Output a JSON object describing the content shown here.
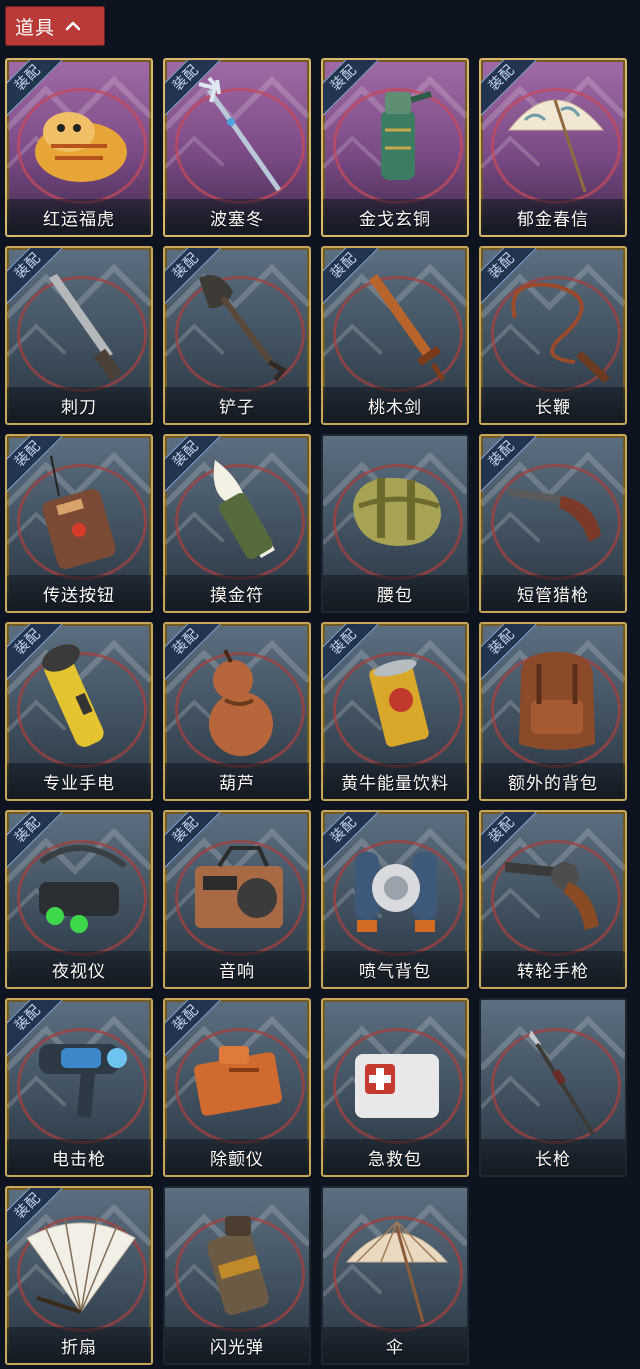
{
  "header": {
    "title": "道具",
    "chevron_icon": "chevron-up-icon"
  },
  "badge_label": "装配",
  "items": [
    {
      "name": "红运福虎",
      "equipped": true,
      "rarity": "purple",
      "gold_frame": true,
      "icon": "tiger-pillow-icon",
      "color": "#e7a437"
    },
    {
      "name": "波塞冬",
      "equipped": true,
      "rarity": "purple",
      "gold_frame": true,
      "icon": "trident-icon",
      "color": "#b9c9d8"
    },
    {
      "name": "金戈玄铜",
      "equipped": true,
      "rarity": "purple",
      "gold_frame": true,
      "icon": "bronze-grenade-icon",
      "color": "#3b7c63"
    },
    {
      "name": "郁金春信",
      "equipped": true,
      "rarity": "purple",
      "gold_frame": true,
      "icon": "paper-umbrella-icon",
      "color": "#f2e7d3"
    },
    {
      "name": "刺刀",
      "equipped": true,
      "rarity": "grey",
      "gold_frame": true,
      "icon": "bayonet-icon",
      "color": "#8a8f93"
    },
    {
      "name": "铲子",
      "equipped": true,
      "rarity": "grey",
      "gold_frame": true,
      "icon": "shovel-icon",
      "color": "#3e3a36"
    },
    {
      "name": "桃木剑",
      "equipped": true,
      "rarity": "grey",
      "gold_frame": true,
      "icon": "wooden-sword-icon",
      "color": "#b8642a"
    },
    {
      "name": "长鞭",
      "equipped": true,
      "rarity": "grey",
      "gold_frame": true,
      "icon": "whip-icon",
      "color": "#9a4b2b"
    },
    {
      "name": "传送按钮",
      "equipped": true,
      "rarity": "grey",
      "gold_frame": true,
      "icon": "remote-button-icon",
      "color": "#7b4a34"
    },
    {
      "name": "摸金符",
      "equipped": true,
      "rarity": "grey",
      "gold_frame": true,
      "icon": "talisman-icon",
      "color": "#556b3c"
    },
    {
      "name": "腰包",
      "equipped": false,
      "rarity": "grey",
      "gold_frame": false,
      "icon": "waist-bag-icon",
      "color": "#a6a354"
    },
    {
      "name": "短管猎枪",
      "equipped": true,
      "rarity": "grey",
      "gold_frame": true,
      "icon": "shotgun-icon",
      "color": "#7a3a27"
    },
    {
      "name": "专业手电",
      "equipped": true,
      "rarity": "grey",
      "gold_frame": true,
      "icon": "flashlight-icon",
      "color": "#e3c32f"
    },
    {
      "name": "葫芦",
      "equipped": true,
      "rarity": "grey",
      "gold_frame": true,
      "icon": "gourd-icon",
      "color": "#b7653a"
    },
    {
      "name": "黄牛能量饮料",
      "equipped": true,
      "rarity": "grey",
      "gold_frame": true,
      "icon": "energy-can-icon",
      "color": "#d9a82a"
    },
    {
      "name": "额外的背包",
      "equipped": true,
      "rarity": "grey",
      "gold_frame": true,
      "icon": "backpack-icon",
      "color": "#8b4a2a"
    },
    {
      "name": "夜视仪",
      "equipped": true,
      "rarity": "grey",
      "gold_frame": true,
      "icon": "night-vision-goggles-icon",
      "color": "#2b2f33"
    },
    {
      "name": "音响",
      "equipped": true,
      "rarity": "grey",
      "gold_frame": true,
      "icon": "radio-icon",
      "color": "#a86a44"
    },
    {
      "name": "喷气背包",
      "equipped": true,
      "rarity": "grey",
      "gold_frame": true,
      "icon": "jetpack-icon",
      "color": "#3d5879"
    },
    {
      "name": "转轮手枪",
      "equipped": true,
      "rarity": "grey",
      "gold_frame": true,
      "icon": "revolver-icon",
      "color": "#3c3b3b"
    },
    {
      "name": "电击枪",
      "equipped": true,
      "rarity": "grey",
      "gold_frame": true,
      "icon": "taser-gun-icon",
      "color": "#3d88c9"
    },
    {
      "name": "除颤仪",
      "equipped": true,
      "rarity": "grey",
      "gold_frame": true,
      "icon": "defibrillator-icon",
      "color": "#d06a2e"
    },
    {
      "name": "急救包",
      "equipped": false,
      "rarity": "grey",
      "gold_frame": true,
      "icon": "first-aid-kit-icon",
      "color": "#e8e8e8"
    },
    {
      "name": "长枪",
      "equipped": false,
      "rarity": "grey",
      "gold_frame": false,
      "icon": "spear-icon",
      "color": "#8d8f91"
    },
    {
      "name": "折扇",
      "equipped": true,
      "rarity": "grey",
      "gold_frame": true,
      "icon": "folding-fan-icon",
      "color": "#f2efe7"
    },
    {
      "name": "闪光弹",
      "equipped": false,
      "rarity": "grey",
      "gold_frame": false,
      "icon": "flashbang-icon",
      "color": "#c08a2b"
    },
    {
      "name": "伞",
      "equipped": false,
      "rarity": "grey",
      "gold_frame": false,
      "icon": "umbrella-icon",
      "color": "#e8d9c0"
    }
  ]
}
